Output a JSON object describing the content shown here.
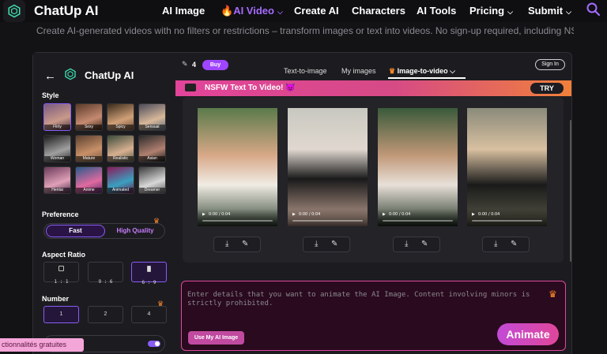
{
  "nav": {
    "brand": "ChatUp AI",
    "items": [
      {
        "label": "AI Image",
        "has_chevron": false
      },
      {
        "label": "AI Video",
        "has_chevron": true,
        "active": true
      },
      {
        "label": "Create AI",
        "has_chevron": false
      },
      {
        "label": "Characters",
        "has_chevron": false
      },
      {
        "label": "AI Tools",
        "has_chevron": false
      },
      {
        "label": "Pricing",
        "has_chevron": true
      },
      {
        "label": "Submit",
        "has_chevron": true
      }
    ],
    "search_icon": "search-icon"
  },
  "subline": "Create AI-generated videos with no filters or restrictions – transform images or text into videos. No sign-up required, including NSFW.",
  "panel": {
    "title": "ChatUp AI",
    "style_label": "Style",
    "styles": [
      {
        "label": "Flirty",
        "selected": true
      },
      {
        "label": "Sexy"
      },
      {
        "label": "Spicy"
      },
      {
        "label": "Sensual"
      },
      {
        "label": "Woman"
      },
      {
        "label": "Mature"
      },
      {
        "label": "Realistic"
      },
      {
        "label": "Asian"
      },
      {
        "label": "Hentai"
      },
      {
        "label": "Anime"
      },
      {
        "label": "Animated"
      },
      {
        "label": "Dreamer"
      }
    ],
    "preference_label": "Preference",
    "preference": {
      "fast": "Fast",
      "high": "High Quality",
      "selected": "Fast"
    },
    "aspect_label": "Aspect Ratio",
    "aspect_ratios": [
      {
        "label": "1 : 1"
      },
      {
        "label": "9 : 6"
      },
      {
        "label": "6 : 9",
        "selected": true
      }
    ],
    "number_label": "Number",
    "numbers": [
      {
        "label": "1",
        "selected": true
      },
      {
        "label": "2"
      },
      {
        "label": "4"
      }
    ]
  },
  "floating_badge": "ctionnalités gratuites",
  "header": {
    "credits": "4",
    "buy_label": "Buy",
    "tabs": [
      {
        "label": "Text-to-image"
      },
      {
        "label": "My images"
      },
      {
        "label": "Image-to-video",
        "active": true
      }
    ],
    "signin_label": "Sign In"
  },
  "banner": {
    "text": "NSFW Text To Video! 😈",
    "try_label": "TRY"
  },
  "videos": [
    {
      "time": "0:00 / 0:04"
    },
    {
      "time": "0:00 / 0:04"
    },
    {
      "time": "0:00 / 0:04"
    },
    {
      "time": "0:00 / 0:04"
    }
  ],
  "prompt": {
    "placeholder": "Enter details that you want to animate the AI Image. Content involving minors is strictly prohibited.",
    "use_my_image": "Use My AI Image",
    "animate": "Animate"
  },
  "colors": {
    "accent": "#8a5cf6",
    "active_nav": "#a66bff",
    "banner_start": "#e2449a",
    "banner_end": "#f1803a",
    "animate_start": "#c24ad6",
    "animate_end": "#e0469a"
  }
}
